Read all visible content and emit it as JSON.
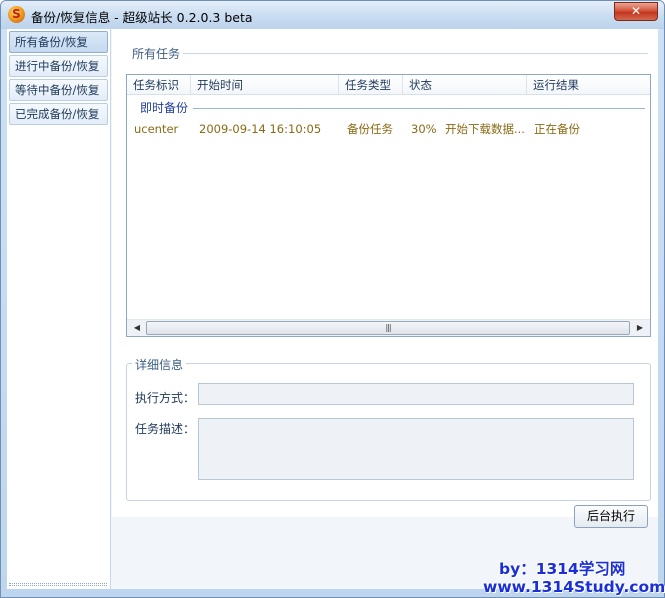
{
  "window": {
    "title": "备份/恢复信息 - 超级站长 0.2.0.3 beta",
    "app_icon_glyph": "S",
    "close_glyph": "✕"
  },
  "sidebar": {
    "items": [
      {
        "label": "所有备份/恢复",
        "active": true
      },
      {
        "label": "进行中备份/恢复",
        "active": false
      },
      {
        "label": "等待中备份/恢复",
        "active": false
      },
      {
        "label": "已完成备份/恢复",
        "active": false
      }
    ]
  },
  "tasks_section": {
    "title": "所有任务",
    "columns": [
      "任务标识",
      "开始时间",
      "任务类型",
      "状态",
      "运行结果"
    ],
    "group": "即时备份",
    "rows": [
      {
        "id": "ucenter",
        "start_time": "2009-09-14 16:10:05",
        "type": "备份任务",
        "status_percent": "30%",
        "status_text": "开始下载数据...",
        "result": "正在备份"
      }
    ],
    "scrollbar": {
      "left_arrow": "◀",
      "right_arrow": "▶",
      "grip": "|||"
    }
  },
  "detail_section": {
    "title": "详细信息",
    "exec_mode_label": "执行方式：",
    "exec_mode_value": "",
    "description_label": "任务描述：",
    "description_value": ""
  },
  "buttons": {
    "run_background": "后台执行"
  },
  "watermark": {
    "line1": "by：1314学习网",
    "line2": "www.1314Study.com"
  },
  "colors": {
    "accent": "#1f3d99",
    "row_text": "#8a6a14",
    "watermark": "#1b2fd6"
  }
}
